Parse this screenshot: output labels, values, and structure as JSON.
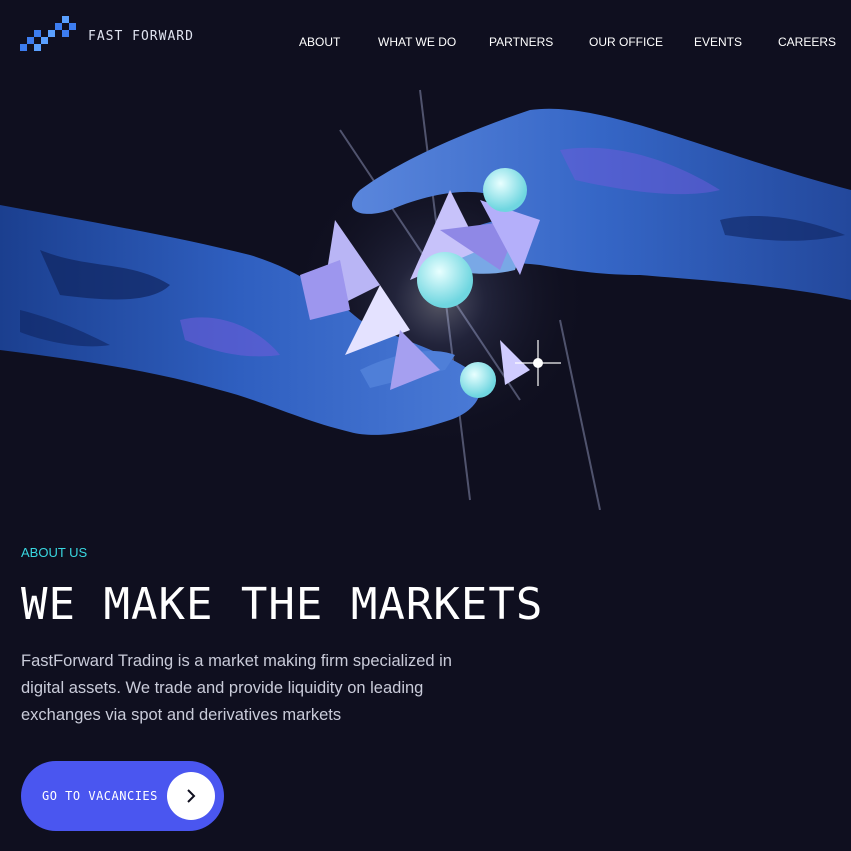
{
  "header": {
    "logo_text": "FAST FORWARD",
    "nav": [
      {
        "label": "ABOUT"
      },
      {
        "label": "WHAT WE DO"
      },
      {
        "label": "PARTNERS"
      },
      {
        "label": "OUR OFFICE"
      },
      {
        "label": "EVENTS"
      },
      {
        "label": "CAREERS"
      }
    ]
  },
  "about": {
    "eyebrow": "ABOUT US",
    "headline": "WE MAKE THE MARKETS",
    "body": "FastForward Trading is a market making firm specialized in digital assets. We trade and provide liquidity on leading exchanges via spot and derivatives markets",
    "cta_label": "GO TO VACANCIES",
    "cta_icon": "chevron-right-icon"
  },
  "colors": {
    "background": "#0f0f1f",
    "accent_cyan": "#39d7e0",
    "button_blue": "#4a56f0",
    "text_muted": "#c9cbd9"
  }
}
